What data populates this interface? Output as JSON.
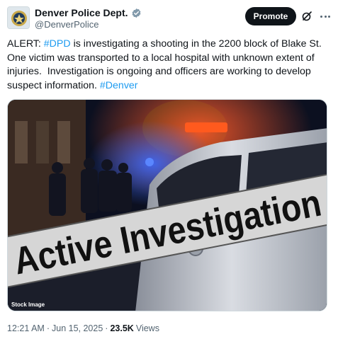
{
  "author": {
    "display_name": "Denver Police Dept.",
    "handle": "@DenverPolice",
    "verified_badge_color": "#829aab"
  },
  "actions": {
    "promote_label": "Promote",
    "grok_icon": "grok-icon",
    "more_icon": "more-icon"
  },
  "tweet": {
    "segments": [
      {
        "text": "ALERT: ",
        "hashtag": false
      },
      {
        "text": "#DPD",
        "hashtag": true
      },
      {
        "text": " is investigating a shooting in the 2200 block of Blake St.  One victim was transported to a local hospital with unknown extent of injuries.  Investigation is ongoing and officers are working to develop suspect information. ",
        "hashtag": false
      },
      {
        "text": "#Denver",
        "hashtag": true
      }
    ]
  },
  "media": {
    "banner_text": "Active Investigation",
    "corner_label": "Stock Image"
  },
  "meta": {
    "time": "12:21 AM",
    "separator": "·",
    "date": "Jun 15, 2025",
    "views_count": "23.5K",
    "views_label": "Views"
  },
  "colors": {
    "hashtag": "#1d9bf0",
    "promote_bg": "#0f1419",
    "secondary_text": "#536471"
  }
}
